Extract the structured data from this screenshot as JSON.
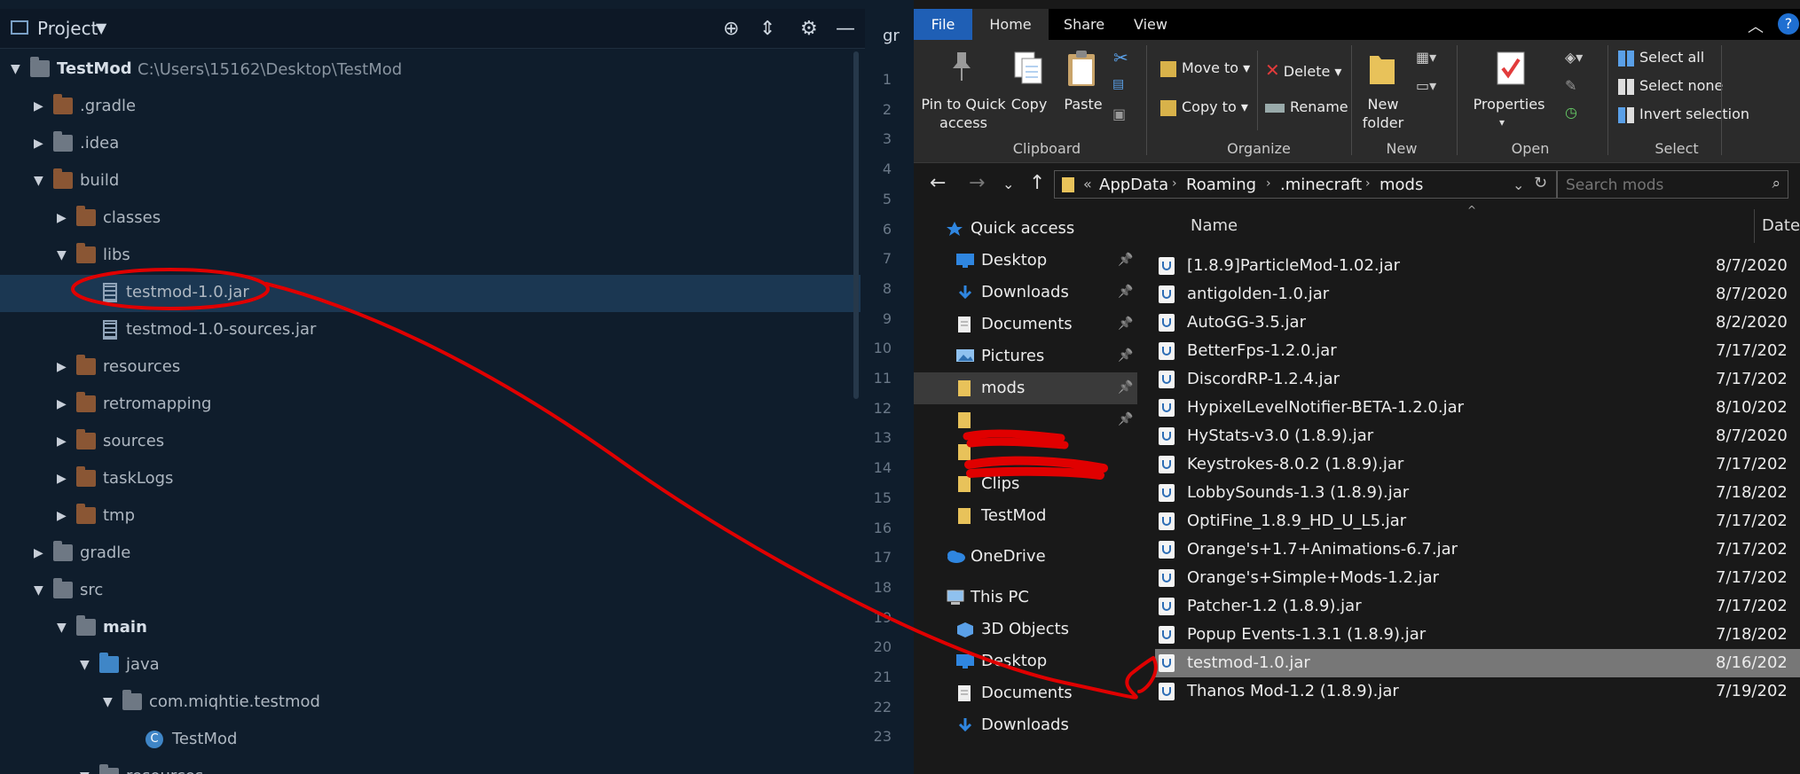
{
  "ide": {
    "panel_title": "Project",
    "gutter_tab": "gr",
    "tree": [
      {
        "label": "TestMod",
        "path": "C:\\Users\\15162\\Desktop\\TestMod",
        "indent": 0,
        "open": true,
        "icon": "module-folder",
        "bold": true
      },
      {
        "label": ".gradle",
        "indent": 1,
        "open": false,
        "icon": "folder"
      },
      {
        "label": ".idea",
        "indent": 1,
        "open": false,
        "icon": "folder-grey"
      },
      {
        "label": "build",
        "indent": 1,
        "open": true,
        "icon": "folder"
      },
      {
        "label": "classes",
        "indent": 2,
        "open": false,
        "icon": "folder"
      },
      {
        "label": "libs",
        "indent": 2,
        "open": true,
        "icon": "folder"
      },
      {
        "label": "testmod-1.0.jar",
        "indent": 3,
        "icon": "jar",
        "selected": true
      },
      {
        "label": "testmod-1.0-sources.jar",
        "indent": 3,
        "icon": "jar"
      },
      {
        "label": "resources",
        "indent": 2,
        "open": false,
        "icon": "folder"
      },
      {
        "label": "retromapping",
        "indent": 2,
        "open": false,
        "icon": "folder"
      },
      {
        "label": "sources",
        "indent": 2,
        "open": false,
        "icon": "folder"
      },
      {
        "label": "taskLogs",
        "indent": 2,
        "open": false,
        "icon": "folder"
      },
      {
        "label": "tmp",
        "indent": 2,
        "open": false,
        "icon": "folder"
      },
      {
        "label": "gradle",
        "indent": 1,
        "open": false,
        "icon": "folder-grey"
      },
      {
        "label": "src",
        "indent": 1,
        "open": true,
        "icon": "folder-grey"
      },
      {
        "label": "main",
        "indent": 2,
        "open": true,
        "icon": "module-folder",
        "bold": true
      },
      {
        "label": "java",
        "indent": 3,
        "open": true,
        "icon": "folder-blue"
      },
      {
        "label": "com.miqhtie.testmod",
        "indent": 4,
        "open": true,
        "icon": "package"
      },
      {
        "label": "TestMod",
        "indent": 5,
        "icon": "class"
      },
      {
        "label": "resources",
        "indent": 3,
        "open": true,
        "icon": "folder-grey"
      }
    ],
    "line_numbers": [
      "1",
      "2",
      "3",
      "4",
      "5",
      "6",
      "7",
      "8",
      "9",
      "10",
      "11",
      "12",
      "13",
      "14",
      "15",
      "16",
      "17",
      "18",
      "19",
      "20",
      "21",
      "22",
      "23"
    ]
  },
  "explorer": {
    "tabs": [
      "File",
      "Home",
      "Share",
      "View"
    ],
    "help": "?",
    "clipboard": {
      "pin": "Pin to Quick access",
      "copy": "Copy",
      "paste": "Paste",
      "group": "Clipboard"
    },
    "organize": {
      "move_to": "Move to",
      "copy_to": "Copy to",
      "delete": "Delete",
      "rename": "Rename",
      "group": "Organize"
    },
    "new": {
      "new_folder": "New folder",
      "group": "New"
    },
    "open": {
      "properties": "Properties",
      "group": "Open"
    },
    "select": {
      "select_all": "Select all",
      "select_none": "Select none",
      "invert": "Invert selection",
      "group": "Select"
    },
    "breadcrumb": [
      "AppData",
      "Roaming",
      ".minecraft",
      "mods"
    ],
    "breadcrumb_prefix": "«",
    "search_placeholder": "Search mods",
    "nav": [
      {
        "label": "Quick access",
        "icon": "star-icon",
        "indent": 0
      },
      {
        "label": "Desktop",
        "icon": "desktop-icon",
        "indent": 1,
        "pinned": true
      },
      {
        "label": "Downloads",
        "icon": "download-icon",
        "indent": 1,
        "pinned": true
      },
      {
        "label": "Documents",
        "icon": "documents-icon",
        "indent": 1,
        "pinned": true
      },
      {
        "label": "Pictures",
        "icon": "pictures-icon",
        "indent": 1,
        "pinned": true
      },
      {
        "label": "mods",
        "icon": "folder-icon",
        "indent": 1,
        "pinned": true,
        "selected": true
      },
      {
        "label": "",
        "icon": "folder-icon",
        "indent": 1,
        "pinned": true,
        "redacted": true
      },
      {
        "label": "",
        "icon": "folder-icon",
        "indent": 1,
        "redacted": true
      },
      {
        "label": "Clips",
        "icon": "folder-icon",
        "indent": 1
      },
      {
        "label": "TestMod",
        "icon": "folder-icon",
        "indent": 1
      },
      {
        "label": "OneDrive",
        "icon": "cloud-icon",
        "indent": 0
      },
      {
        "label": "This PC",
        "icon": "pc-icon",
        "indent": 0
      },
      {
        "label": "3D Objects",
        "icon": "cube-icon",
        "indent": 1
      },
      {
        "label": "Desktop",
        "icon": "desktop-icon",
        "indent": 1
      },
      {
        "label": "Documents",
        "icon": "documents-icon",
        "indent": 1
      },
      {
        "label": "Downloads",
        "icon": "download-icon",
        "indent": 1
      }
    ],
    "columns": {
      "name": "Name",
      "date": "Date mo"
    },
    "files": [
      {
        "name": "[1.8.9]ParticleMod-1.02.jar",
        "date": "8/7/2020"
      },
      {
        "name": "antigolden-1.0.jar",
        "date": "8/7/2020"
      },
      {
        "name": "AutoGG-3.5.jar",
        "date": "8/2/2020"
      },
      {
        "name": "BetterFps-1.2.0.jar",
        "date": "7/17/202"
      },
      {
        "name": "DiscordRP-1.2.4.jar",
        "date": "7/17/202"
      },
      {
        "name": "HypixelLevelNotifier-BETA-1.2.0.jar",
        "date": "8/10/202"
      },
      {
        "name": "HyStats-v3.0 (1.8.9).jar",
        "date": "8/7/2020"
      },
      {
        "name": "Keystrokes-8.0.2 (1.8.9).jar",
        "date": "7/17/202"
      },
      {
        "name": "LobbySounds-1.3 (1.8.9).jar",
        "date": "7/18/202"
      },
      {
        "name": "OptiFine_1.8.9_HD_U_L5.jar",
        "date": "7/17/202"
      },
      {
        "name": "Orange's+1.7+Animations-6.7.jar",
        "date": "7/17/202"
      },
      {
        "name": "Orange's+Simple+Mods-1.2.jar",
        "date": "7/17/202"
      },
      {
        "name": "Patcher-1.2 (1.8.9).jar",
        "date": "7/17/202"
      },
      {
        "name": "Popup Events-1.3.1 (1.8.9).jar",
        "date": "7/18/202"
      },
      {
        "name": "testmod-1.0.jar",
        "date": "8/16/202",
        "selected": true
      },
      {
        "name": "Thanos Mod-1.2 (1.8.9).jar",
        "date": "7/19/202"
      }
    ]
  },
  "annotation_color": "#e00000"
}
